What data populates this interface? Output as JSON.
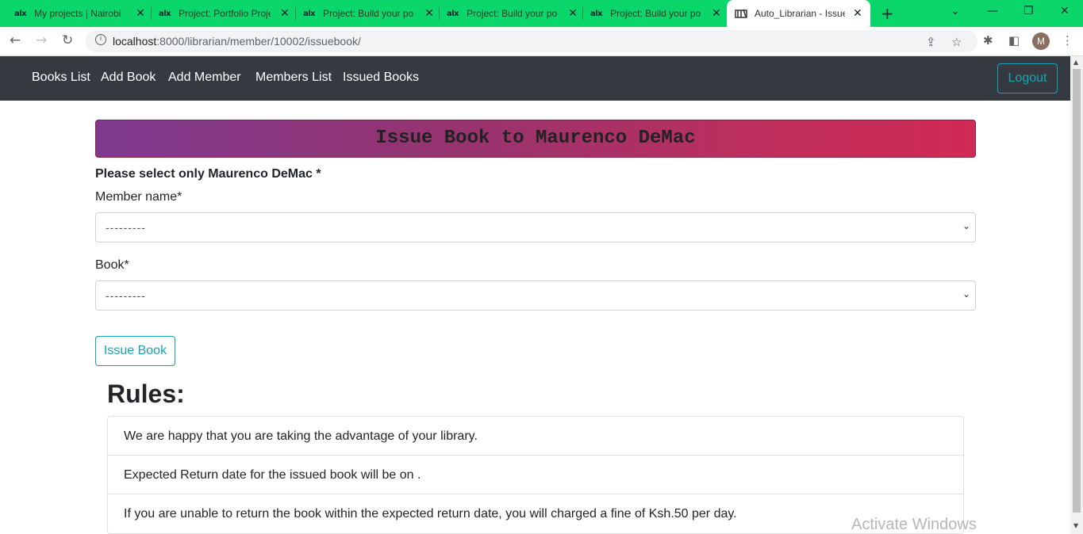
{
  "browser": {
    "tabs": [
      {
        "favicon": "alx",
        "title": "My projects | Nairobi"
      },
      {
        "favicon": "alx",
        "title": "Project: Portfolio Proje"
      },
      {
        "favicon": "alx",
        "title": "Project: Build your po"
      },
      {
        "favicon": "alx",
        "title": "Project: Build your po"
      },
      {
        "favicon": "alx",
        "title": "Project: Build your po"
      },
      {
        "favicon": "book-icon",
        "title": "Auto_Librarian - Issue"
      }
    ],
    "address": {
      "host": "localhost",
      "path": ":8000/librarian/member/10002/issuebook/"
    },
    "profile_initial": "M",
    "accent_color": "#0bd66a"
  },
  "navbar": {
    "links": [
      "Books List",
      "Add Book",
      "Add Member",
      "Members List",
      "Issued Books"
    ],
    "logout_label": "Logout"
  },
  "page": {
    "heading": "Issue Book to Maurenco DeMac",
    "note": "Please select only Maurenco DeMac *",
    "form": {
      "member_label": "Member name*",
      "member_value": "---------",
      "book_label": "Book*",
      "book_value": "---------",
      "submit_label": "Issue Book"
    },
    "rules": {
      "title": "Rules:",
      "items": [
        "We are happy that you are taking the advantage of your library.",
        "Expected Return date for the issued book will be on .",
        "If you are unable to return the book within the expected return date, you will charged a fine of Ksh.50 per day."
      ]
    }
  },
  "overlay": {
    "watermark": "Activate Windows"
  }
}
